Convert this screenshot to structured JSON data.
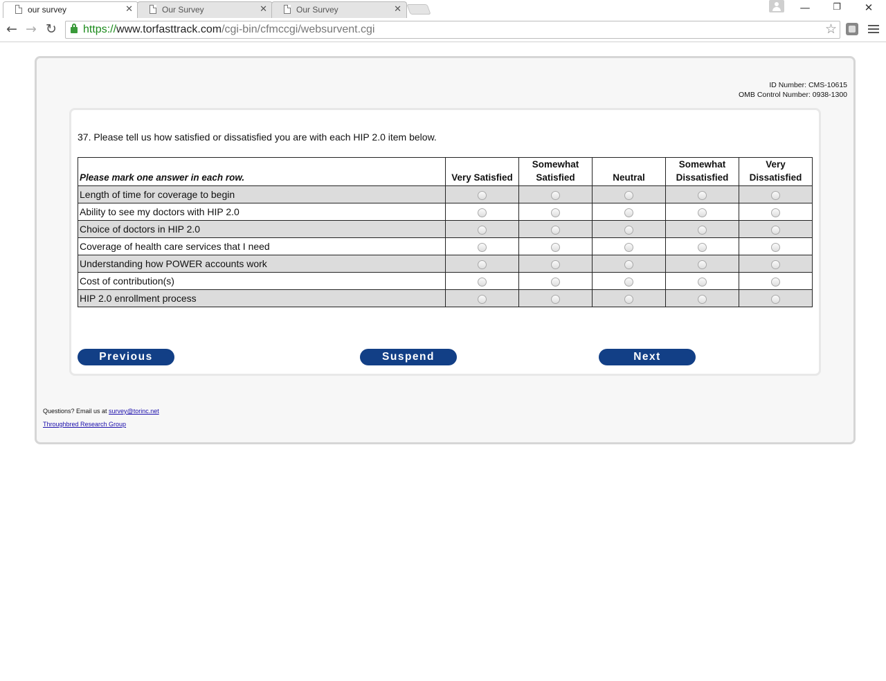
{
  "browser": {
    "tabs": [
      {
        "title": "our survey",
        "active": true
      },
      {
        "title": "Our Survey",
        "active": false
      },
      {
        "title": "Our Survey",
        "active": false
      }
    ],
    "url": {
      "scheme": "https://",
      "host": "www.torfasttrack.com",
      "path": "/cgi-bin/cfmccgi/websurvent.cgi"
    },
    "window_controls": {
      "minimize": "—",
      "restore": "❐",
      "close": "✕"
    }
  },
  "header": {
    "id_number": "ID Number: CMS-10615",
    "omb_control": "OMB Control Number: 0938-1300"
  },
  "question": {
    "text": "37. Please tell us how satisfied or dissatisfied you are with each HIP 2.0 item below.",
    "instruction": "Please mark one answer in each row.",
    "columns": [
      "Very Satisfied",
      "Somewhat Satisfied",
      "Neutral",
      "Somewhat Dissatisfied",
      "Very Dissatisfied"
    ],
    "items": [
      "Length of time for coverage to begin",
      "Ability to see my doctors with HIP 2.0",
      "Choice of doctors in HIP 2.0",
      "Coverage of health care services that I need",
      "Understanding how POWER accounts work",
      "Cost of contribution(s)",
      "HIP 2.0 enrollment process"
    ]
  },
  "buttons": {
    "previous": "Previous",
    "suspend": "Suspend",
    "next": "Next"
  },
  "footer": {
    "questions_prefix": "Questions? Email us at ",
    "email": "survey@torinc.net",
    "company": "Throughbred Research Group"
  },
  "colors": {
    "button_bg": "#123f86",
    "row_shade": "#dcdcdc",
    "secure_green": "#1b8a1b"
  }
}
